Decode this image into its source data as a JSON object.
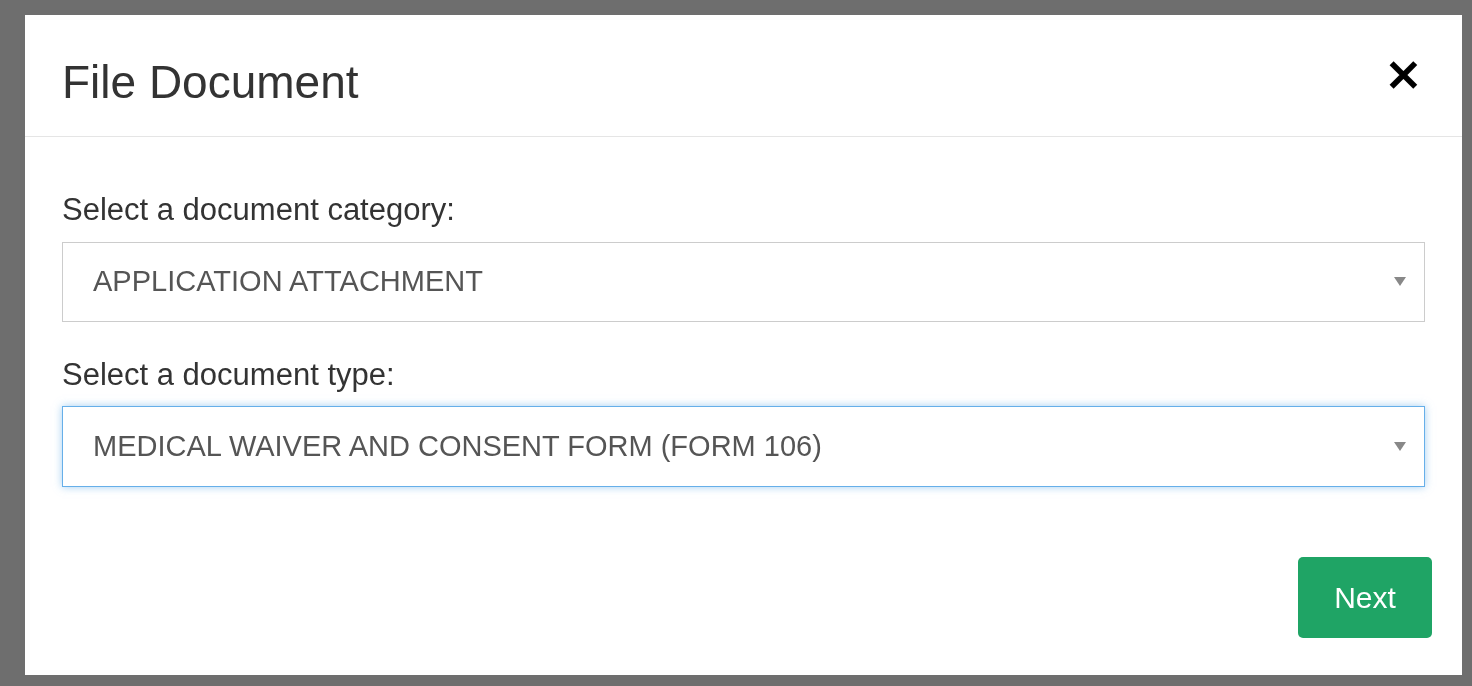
{
  "dialog": {
    "title": "File Document",
    "close": "✕",
    "fields": [
      {
        "label": "Select a document category:",
        "value": "APPLICATION ATTACHMENT",
        "focused": false
      },
      {
        "label": "Select a document type:",
        "value": "MEDICAL WAIVER AND CONSENT FORM (FORM 106)",
        "focused": true
      }
    ],
    "primary_button": "Next"
  }
}
